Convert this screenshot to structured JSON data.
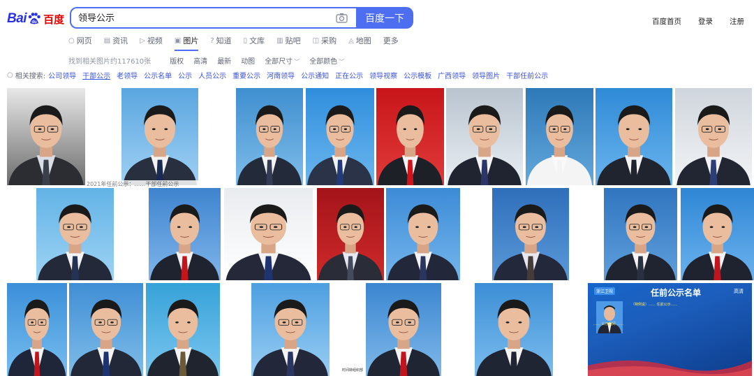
{
  "logo": {
    "bai": "Bai",
    "du": "du",
    "cn": "百度"
  },
  "search": {
    "query": "领导公示",
    "button": "百度一下"
  },
  "top_links": [
    "百度首页",
    "登录",
    "注册"
  ],
  "nav": {
    "tabs": [
      {
        "icon": "search-icon",
        "glyph": "○",
        "label": "网页"
      },
      {
        "icon": "news-icon",
        "glyph": "▤",
        "label": "资讯"
      },
      {
        "icon": "video-icon",
        "glyph": "▷",
        "label": "视频"
      },
      {
        "icon": "image-icon",
        "glyph": "▣",
        "label": "图片",
        "active": true
      },
      {
        "icon": "zhidao-icon",
        "glyph": "?",
        "label": "知道"
      },
      {
        "icon": "wenku-icon",
        "glyph": "▯",
        "label": "文库"
      },
      {
        "icon": "tieba-icon",
        "glyph": "▥",
        "label": "贴吧"
      },
      {
        "icon": "caigou-icon",
        "glyph": "◫",
        "label": "采购"
      },
      {
        "icon": "map-icon",
        "glyph": "◬",
        "label": "地图"
      },
      {
        "icon": "",
        "glyph": "",
        "label": "更多"
      }
    ]
  },
  "filters": {
    "count_text": "找到相关图片约117610张",
    "items": [
      {
        "label": "版权",
        "dropdown": false
      },
      {
        "label": "高清",
        "dropdown": false
      },
      {
        "label": "最新",
        "dropdown": false
      },
      {
        "label": "动图",
        "dropdown": false
      },
      {
        "label": "全部尺寸",
        "dropdown": true
      },
      {
        "label": "全部颜色",
        "dropdown": true
      }
    ]
  },
  "related": {
    "label": "相关搜索:",
    "keywords": [
      "公司领导",
      "干部公示",
      "老领导",
      "公示名单",
      "公示",
      "人员公示",
      "重要公示",
      "河南领导",
      "公示通知",
      "正在公示",
      "领导视察",
      "公示模板",
      "广西领导",
      "领导图片",
      "干部任前公示"
    ]
  },
  "images": [
    {
      "bg": "#e8e8e8",
      "bg2": "#6d6d6d",
      "suit": "#2b2d33",
      "tie": "#3b3f4a",
      "shirt": "#d9dde6"
    },
    {
      "bg": "#5aa6e0",
      "bg2": "#9fd0f3",
      "suit": "#283040",
      "tie": "#1b2a52",
      "shirt": "#f2f2f2"
    },
    {
      "bg": "#3f8fd0",
      "bg2": "#7fbde9",
      "suit": "#232a3a",
      "tie": "#333b55",
      "shirt": "#f4f4f4"
    },
    {
      "bg": "#2f8edc",
      "bg2": "#6cb6ee",
      "suit": "#2a3348",
      "tie": "#243a78",
      "shirt": "#f3f3f3"
    },
    {
      "bg": "#c8161a",
      "bg2": "#e03a3a",
      "suit": "#1e2028",
      "tie": "#d0121b",
      "shirt": "#f5f5f5"
    },
    {
      "bg": "#b9c4cf",
      "bg2": "#e9eef2",
      "suit": "#1f2430",
      "tie": "#2b3566",
      "shirt": "#f4f4f4"
    },
    {
      "bg": "#2e79b8",
      "bg2": "#63a8dc",
      "suit": "#f4f4f4",
      "tie": "#f4f4f4",
      "shirt": "#fafafa"
    },
    {
      "bg": "#2f8ad6",
      "bg2": "#6ab4ee",
      "suit": "#20242e",
      "tie": "#20242e",
      "shirt": "#f4f4f4"
    },
    {
      "bg": "#cfd5dc",
      "bg2": "#f2f4f6",
      "suit": "#222633",
      "tie": "#2c3e74",
      "shirt": "#f4f4f4"
    },
    {
      "bg": "#62b3e6",
      "bg2": "#9ed3f4",
      "suit": "#24293a",
      "tie": "#243353",
      "shirt": "#f4f4f4"
    },
    {
      "bg": "#3f84cf",
      "bg2": "#7fb5ea",
      "suit": "#1f2330",
      "tie": "#c3161c",
      "shirt": "#f4f4f4"
    },
    {
      "bg": "#e9ecef",
      "bg2": "#ffffff",
      "suit": "#242838",
      "tie": "#1d3470",
      "shirt": "#f4f4f4"
    },
    {
      "bg": "#a3141a",
      "bg2": "#cf2a2a",
      "suit": "#2a2c38",
      "tie": "#454a5c",
      "shirt": "#e6e9f2"
    },
    {
      "bg": "#3c8bd6",
      "bg2": "#74b5ec",
      "suit": "#22283a",
      "tie": "#2a3560",
      "shirt": "#f4f4f4"
    },
    {
      "bg": "#2f6fbb",
      "bg2": "#5a99d8",
      "suit": "#23283a",
      "tie": "#443b3b",
      "shirt": "#e8e6ee"
    },
    {
      "bg": "#3075bf",
      "bg2": "#5f9fdc",
      "suit": "#1f2430",
      "tie": "#2b3040",
      "shirt": "#f4f4f4"
    },
    {
      "bg": "#2f86d4",
      "bg2": "#6bb2ee",
      "suit": "#1e232f",
      "tie": "#c0151c",
      "shirt": "#f4f4f4"
    },
    {
      "bg": "#3b8fd8",
      "bg2": "#77bdf0",
      "suit": "#20263a",
      "tie": "#c0151c",
      "shirt": "#f4f4f4"
    },
    {
      "bg": "#3f8ed4",
      "bg2": "#7fbde9",
      "suit": "#222838",
      "tie": "#1d3470",
      "shirt": "#f4f4f4"
    },
    {
      "bg": "#36a2d8",
      "bg2": "#7ac6ef",
      "suit": "#20242f",
      "tie": "#6b5a3a",
      "shirt": "#f4f4f4"
    },
    {
      "bg": "#4d9fe0",
      "bg2": "#98cdf3",
      "suit": "#22283a",
      "tie": "#2a3560",
      "shirt": "#f4f4f4"
    },
    {
      "bg": "#3b86d0",
      "bg2": "#7fb8ea",
      "suit": "#1f2533",
      "tie": "#c0151c",
      "shirt": "#f4f4f4"
    },
    {
      "bg": "#3c8ed6",
      "bg2": "#7bbdee",
      "suit": "#1f2532",
      "tie": "#1f2532",
      "shirt": "#f4f4f4"
    }
  ],
  "overlay_caption": "2021年任前公示：……干部任前公示",
  "tiny_label": "时间转组织部",
  "notice": {
    "channel": "浙江卫视",
    "title": "任前公示名单",
    "hd": "高清",
    "body1": "（特例说）…… 任前公示……",
    "body2": "…… 公示期间 ……"
  }
}
